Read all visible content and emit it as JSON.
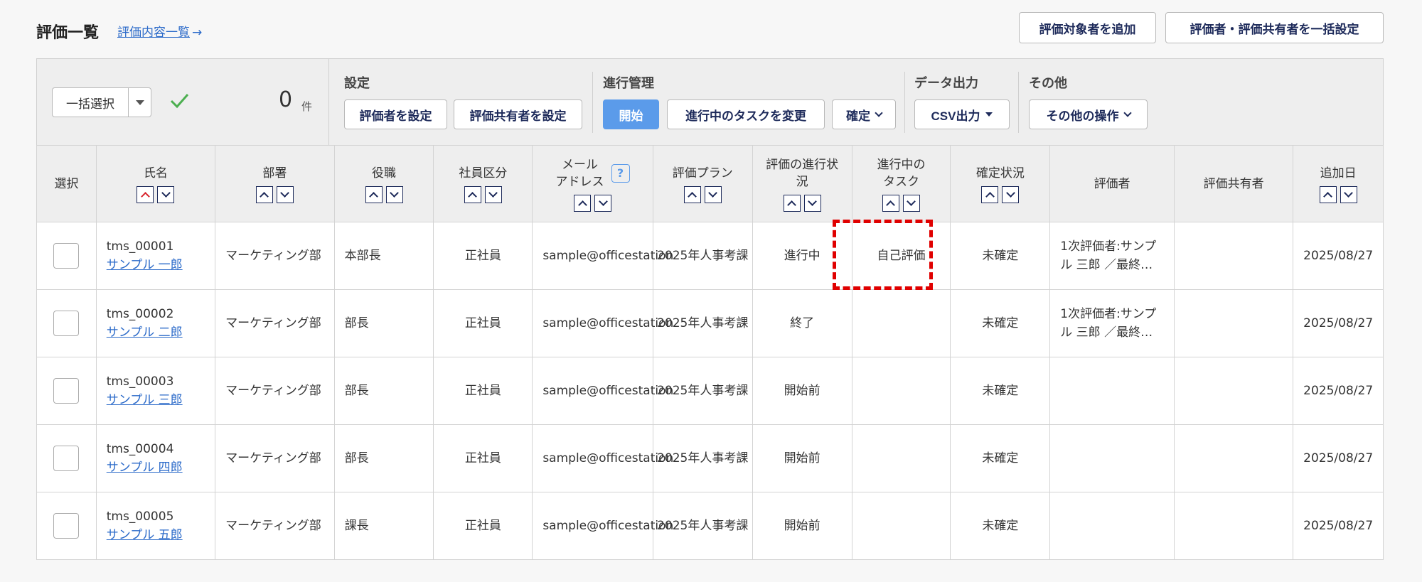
{
  "header": {
    "title": "評価一覧",
    "content_link": "評価内容一覧",
    "content_link_arrow": "→",
    "add_target_button": "評価対象者を追加",
    "bulk_assign_button": "評価者・評価共有者を一括設定"
  },
  "toolbar": {
    "bulk_select_label": "一括選択",
    "count": "0",
    "count_unit": "件",
    "groups": {
      "settings": {
        "title": "設定",
        "evaluator_button": "評価者を設定",
        "sharer_button": "評価共有者を設定"
      },
      "progress": {
        "title": "進行管理",
        "start_button": "開始",
        "change_task_button": "進行中のタスクを変更",
        "confirm_button": "確定"
      },
      "export": {
        "title": "データ出力",
        "csv_button": "CSV出力"
      },
      "other": {
        "title": "その他",
        "other_ops_button": "その他の操作"
      }
    }
  },
  "columns": {
    "select": "選択",
    "name": "氏名",
    "dept": "部署",
    "position": "役職",
    "employment": "社員区分",
    "email_line1": "メール",
    "email_line2": "アドレス",
    "email_help": "?",
    "plan": "評価プラン",
    "status_line1": "評価の進行状",
    "status_line2": "況",
    "task_line1": "進行中の",
    "task_line2": "タスク",
    "confirm": "確定状況",
    "evaluator": "評価者",
    "sharer": "評価共有者",
    "added": "追加日"
  },
  "rows": [
    {
      "id": "tms_00001",
      "name": "サンプル 一郎",
      "dept": "マーケティング部",
      "position": "本部長",
      "employment": "正社員",
      "email": "sample@officestation",
      "plan": "2025年人事考課",
      "status": "進行中",
      "task": "自己評価",
      "confirm": "未確定",
      "evaluator": "1次評価者:サンプル 三郎 ／最終…",
      "sharer": "",
      "added": "2025/08/27"
    },
    {
      "id": "tms_00002",
      "name": "サンプル 二郎",
      "dept": "マーケティング部",
      "position": "部長",
      "employment": "正社員",
      "email": "sample@officestation",
      "plan": "2025年人事考課",
      "status": "終了",
      "task": "",
      "confirm": "未確定",
      "evaluator": "1次評価者:サンプル 三郎 ／最終…",
      "sharer": "",
      "added": "2025/08/27"
    },
    {
      "id": "tms_00003",
      "name": "サンプル 三郎",
      "dept": "マーケティング部",
      "position": "部長",
      "employment": "正社員",
      "email": "sample@officestation",
      "plan": "2025年人事考課",
      "status": "開始前",
      "task": "",
      "confirm": "未確定",
      "evaluator": "",
      "sharer": "",
      "added": "2025/08/27"
    },
    {
      "id": "tms_00004",
      "name": "サンプル 四郎",
      "dept": "マーケティング部",
      "position": "部長",
      "employment": "正社員",
      "email": "sample@officestation",
      "plan": "2025年人事考課",
      "status": "開始前",
      "task": "",
      "confirm": "未確定",
      "evaluator": "",
      "sharer": "",
      "added": "2025/08/27"
    },
    {
      "id": "tms_00005",
      "name": "サンプル 五郎",
      "dept": "マーケティング部",
      "position": "課長",
      "employment": "正社員",
      "email": "sample@officestation",
      "plan": "2025年人事考課",
      "status": "開始前",
      "task": "",
      "confirm": "未確定",
      "evaluator": "",
      "sharer": "",
      "added": "2025/08/27"
    }
  ],
  "colors": {
    "link": "#2b6ac9",
    "primary_button": "#5b9bea",
    "check": "#4caf50",
    "highlight": "#e00000",
    "active_sort": "#d8242d"
  }
}
